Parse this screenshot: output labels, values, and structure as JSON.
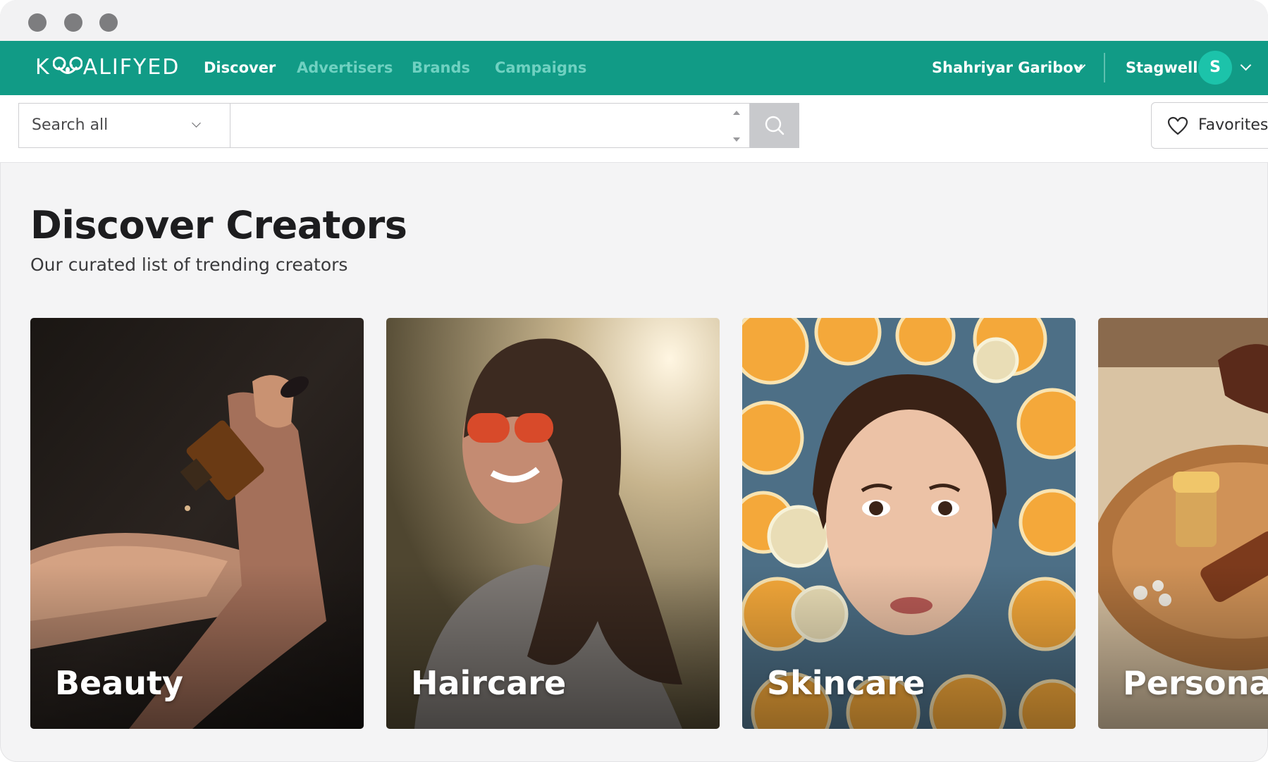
{
  "window": {
    "controls": [
      "close",
      "minimize",
      "maximize"
    ]
  },
  "brand": {
    "logo_text_a": "K",
    "logo_text_b": "ALIFYED",
    "logo_icon": "koala-icon"
  },
  "nav": {
    "links": [
      {
        "label": "Discover",
        "active": true
      },
      {
        "label": "Advertisers",
        "active": false
      },
      {
        "label": "Brands",
        "active": false
      },
      {
        "label": "Campaigns",
        "active": false
      }
    ],
    "user_name": "Shahriyar Garibov",
    "org_name": "Stagwell",
    "avatar_initial": "S"
  },
  "search": {
    "scope_label": "Search all",
    "query": "",
    "favorites_label": "Favorites"
  },
  "page": {
    "title": "Discover Creators",
    "subtitle": "Our curated list of trending creators"
  },
  "categories": [
    {
      "label": "Beauty"
    },
    {
      "label": "Haircare"
    },
    {
      "label": "Skincare"
    },
    {
      "label": "Personal"
    }
  ],
  "colors": {
    "brand_teal": "#119b86",
    "nav_inactive": "#6fd1c1",
    "avatar": "#1cc3aa"
  }
}
